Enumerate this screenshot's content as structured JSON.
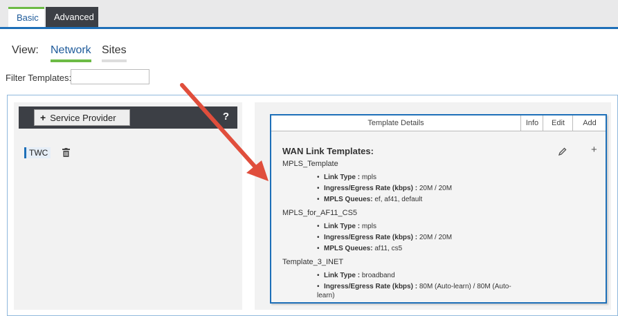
{
  "tabs": {
    "basic": "Basic",
    "advanced": "Advanced"
  },
  "view": {
    "label": "View:",
    "network": "Network",
    "sites": "Sites"
  },
  "filter": {
    "label": "Filter Templates:",
    "value": ""
  },
  "service_provider": {
    "button_label": "Service Provider",
    "help": "?",
    "items": [
      {
        "label": "TWC"
      }
    ]
  },
  "details": {
    "header": {
      "title": "Template Details",
      "info": "Info",
      "edit": "Edit",
      "add": "Add"
    },
    "section_title": "WAN Link Templates:",
    "add_symbol": "+",
    "templates": [
      {
        "name": "MPLS_Template",
        "fields": [
          {
            "label": "Link Type :",
            "value": " mpls"
          },
          {
            "label": "Ingress/Egress Rate (kbps) :",
            "value": " 20M / 20M"
          },
          {
            "label": "MPLS Queues:",
            "value": " ef, af41, default"
          }
        ]
      },
      {
        "name": "MPLS_for_AF11_CS5",
        "fields": [
          {
            "label": "Link Type :",
            "value": " mpls"
          },
          {
            "label": "Ingress/Egress Rate (kbps) :",
            "value": " 20M / 20M"
          },
          {
            "label": "MPLS Queues:",
            "value": " af11, cs5"
          }
        ]
      },
      {
        "name": "Template_3_INET",
        "fields": [
          {
            "label": "Link Type :",
            "value": " broadband"
          },
          {
            "label": "Ingress/Egress Rate (kbps) :",
            "value": " 80M (Auto-learn) / 80M (Auto-learn)"
          }
        ]
      }
    ]
  },
  "colors": {
    "accent_blue": "#1d6fb8",
    "accent_green": "#6cbb45",
    "dark_bar": "#3c3f45",
    "arrow": "#e04e3c"
  }
}
